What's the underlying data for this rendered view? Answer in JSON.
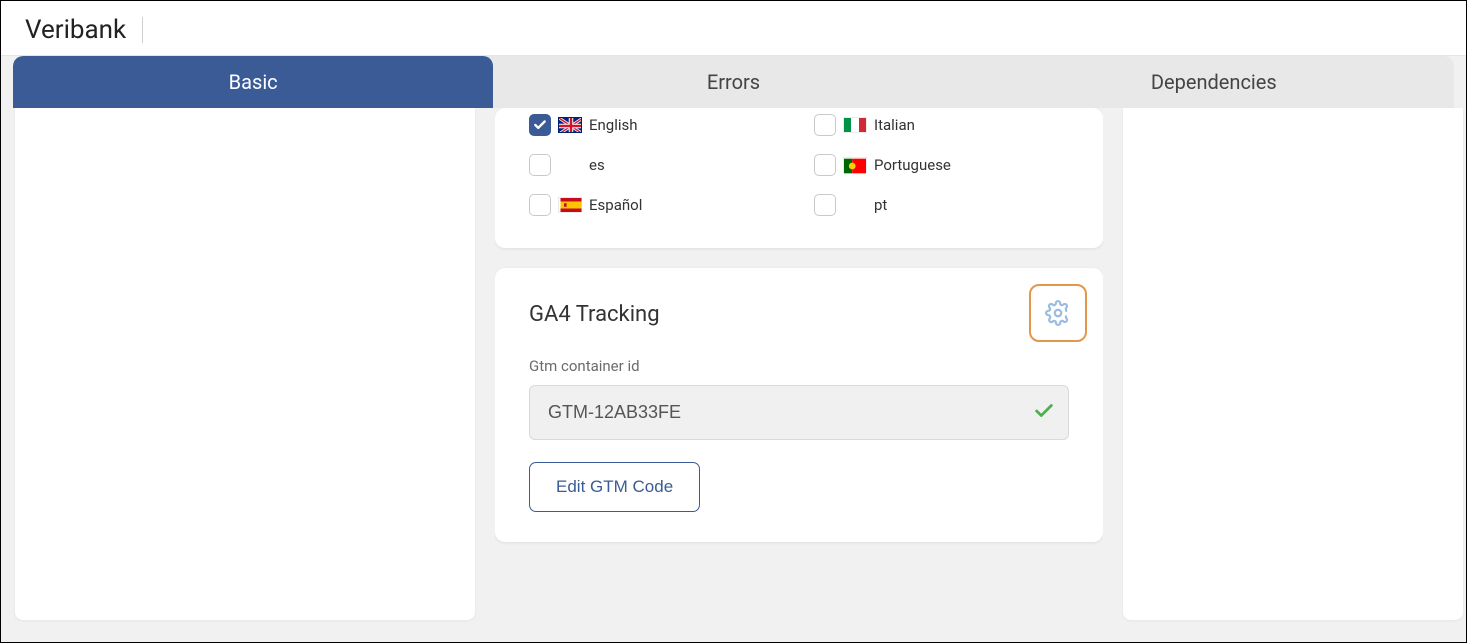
{
  "header": {
    "title": "Veribank"
  },
  "tabs": [
    {
      "label": "Basic",
      "active": true
    },
    {
      "label": "Errors",
      "active": false
    },
    {
      "label": "Dependencies",
      "active": false
    }
  ],
  "languages": {
    "left": [
      {
        "label": "English",
        "checked": true,
        "flag": "uk"
      },
      {
        "label": "es",
        "checked": false,
        "flag": ""
      },
      {
        "label": "Español",
        "checked": false,
        "flag": "es"
      }
    ],
    "right": [
      {
        "label": "Italian",
        "checked": false,
        "flag": "it"
      },
      {
        "label": "Portuguese",
        "checked": false,
        "flag": "pt"
      },
      {
        "label": "pt",
        "checked": false,
        "flag": ""
      }
    ]
  },
  "ga4": {
    "title": "GA4 Tracking",
    "field_label": "Gtm container id",
    "value": "GTM-12AB33FE",
    "edit_button": "Edit GTM Code"
  }
}
